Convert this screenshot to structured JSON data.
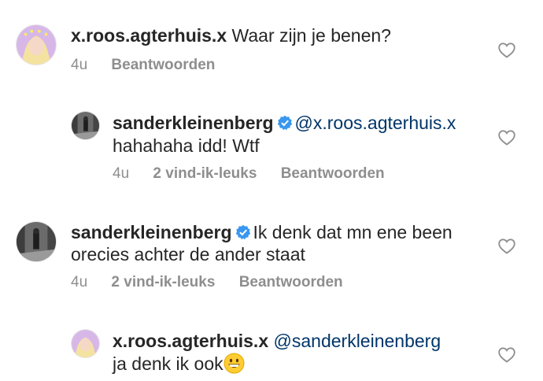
{
  "comments": [
    {
      "username": "x.roos.agterhuis.x",
      "text": "Waar zijn je benen?",
      "time": "4u",
      "reply_label": "Beantwoorden"
    },
    {
      "username": "sanderkleinenberg",
      "mention": "@x.roos.agterhuis.x",
      "text": "hahahaha idd! Wtf",
      "time": "4u",
      "likes": "2 vind-ik-leuks",
      "reply_label": "Beantwoorden"
    },
    {
      "username": "sanderkleinenberg",
      "text_line1": "Ik denk dat mn ene been",
      "text_line2": "orecies achter de ander staat",
      "time": "4u",
      "likes": "2 vind-ik-leuks",
      "reply_label": "Beantwoorden"
    },
    {
      "username": "x.roos.agterhuis.x",
      "mention": "@sanderkleinenberg",
      "text": "ja denk ik ook",
      "emoji": "grinning-face-emoji"
    }
  ],
  "icons": {
    "like": "heart-outline-icon",
    "verified": "verified-badge-icon"
  },
  "colors": {
    "text": "#262626",
    "meta": "#8e8e8e",
    "mention": "#003569",
    "verified": "#3897f0"
  }
}
